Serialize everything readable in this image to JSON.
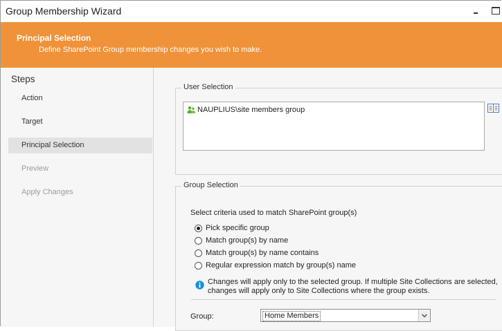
{
  "window": {
    "title": "Group Membership Wizard"
  },
  "header": {
    "title": "Principal Selection",
    "subtitle": "Define SharePoint Group membership changes you wish to make."
  },
  "steps": {
    "title": "Steps",
    "items": [
      {
        "label": "Action",
        "state": "normal"
      },
      {
        "label": "Target",
        "state": "normal"
      },
      {
        "label": "Principal Selection",
        "state": "active"
      },
      {
        "label": "Preview",
        "state": "disabled"
      },
      {
        "label": "Apply Changes",
        "state": "disabled"
      }
    ]
  },
  "user_selection": {
    "legend": "User Selection",
    "entries": [
      {
        "label": "NAUPLIUS\\site members group",
        "icon": "user-group-icon"
      }
    ],
    "address_book_icon": "address-book-icon"
  },
  "group_selection": {
    "legend": "Group Selection",
    "criteria_label": "Select criteria used to match SharePoint group(s)",
    "options": [
      {
        "label": "Pick specific group",
        "checked": true
      },
      {
        "label": "Match group(s) by name",
        "checked": false
      },
      {
        "label": "Match group(s) by name contains",
        "checked": false
      },
      {
        "label": "Regular expression match by group(s) name",
        "checked": false
      }
    ],
    "info_line1": "Changes will apply only to the selected group. If multiple Site Collections are selected,",
    "info_line2": "changes will apply only to Site Collections where the group exists.",
    "group_label": "Group:",
    "group_value": "Home Members"
  },
  "colors": {
    "header_bg": "#f0923a",
    "panel_bg": "#f6f6f6",
    "active_step_bg": "#e2e2e2",
    "info_blue": "#1a8fd8",
    "user_icon_green": "#5aa832"
  }
}
